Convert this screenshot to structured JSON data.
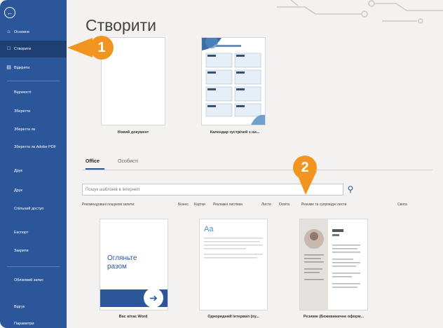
{
  "sidebar": {
    "items": [
      {
        "label": "Основне",
        "icon": "home-icon"
      },
      {
        "label": "Створити",
        "icon": "new-doc-icon"
      },
      {
        "label": "Відкрити",
        "icon": "folder-icon"
      },
      {
        "label": "Відомості"
      },
      {
        "label": "Зберегти"
      },
      {
        "label": "Зберегти як"
      },
      {
        "label": "Зберегти як Adobe PDF"
      },
      {
        "label": "Друк"
      },
      {
        "label": "Друк"
      },
      {
        "label": "Спільний доступ"
      },
      {
        "label": "Експорт"
      },
      {
        "label": "Закрити"
      },
      {
        "label": "Обліковий запис"
      },
      {
        "label": "Відгук"
      },
      {
        "label": "Параметри"
      }
    ]
  },
  "main": {
    "title": "Створити",
    "featured": [
      {
        "caption": "Новий документ"
      },
      {
        "caption": "Календар зустрічей з ни..."
      }
    ],
    "tabs": [
      {
        "label": "Office"
      },
      {
        "label": "Особисті"
      }
    ],
    "search": {
      "placeholder": "Пошук шаблонів в Інтернеті"
    },
    "categories": [
      "Рекомендовані пошукові запити:",
      "Бізнес",
      "Картки",
      "Рекламні листівки",
      "Листи",
      "Освіта",
      "Резюме та супровідні листи",
      "Свята"
    ],
    "templates": [
      {
        "caption": "Вас вітає Word",
        "cover_text": "Огляньте разом"
      },
      {
        "caption": "Однорядний інтервал (пу...",
        "cover_text": "Aa"
      },
      {
        "caption": "Резюме (Бежевиничне оформ..."
      }
    ]
  },
  "callouts": [
    "1",
    "2"
  ],
  "colors": {
    "sidebar": "#2b579a",
    "accent": "#f29520"
  }
}
